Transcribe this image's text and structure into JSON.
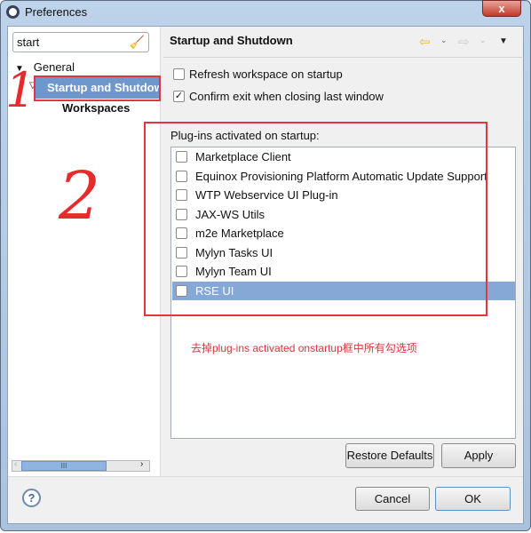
{
  "window": {
    "title": "Preferences",
    "close_label": "x"
  },
  "filter": {
    "value": "start"
  },
  "tree": {
    "items": [
      {
        "label": "General"
      },
      {
        "label": "Startup and Shutdown",
        "selected": true
      },
      {
        "label": "Workspaces"
      }
    ],
    "scroll_glyph": "III"
  },
  "page": {
    "title": "Startup and Shutdown",
    "options": [
      {
        "label": "Refresh workspace on startup",
        "checked": false
      },
      {
        "label": "Confirm exit when closing last window",
        "checked": true
      }
    ],
    "plugins_label": "Plug-ins activated on startup:",
    "plugins": [
      {
        "label": "Marketplace Client",
        "checked": false
      },
      {
        "label": "Equinox Provisioning Platform Automatic Update Support",
        "checked": false
      },
      {
        "label": "WTP Webservice UI Plug-in",
        "checked": false
      },
      {
        "label": "JAX-WS Utils",
        "checked": false
      },
      {
        "label": "m2e Marketplace",
        "checked": false
      },
      {
        "label": "Mylyn Tasks UI",
        "checked": false
      },
      {
        "label": "Mylyn Team UI",
        "checked": false
      },
      {
        "label": "RSE UI",
        "checked": false,
        "selected": true
      }
    ],
    "restore_defaults": "Restore Defaults",
    "apply": "Apply"
  },
  "footer": {
    "cancel": "Cancel",
    "ok": "OK",
    "help": "?"
  },
  "annotations": {
    "mark1": "1",
    "mark2": "2",
    "note": "去掉plug-ins activated onstartup框中所有勾选项",
    "color": "#e0363c"
  },
  "colors": {
    "selection": "#6e97cd"
  }
}
